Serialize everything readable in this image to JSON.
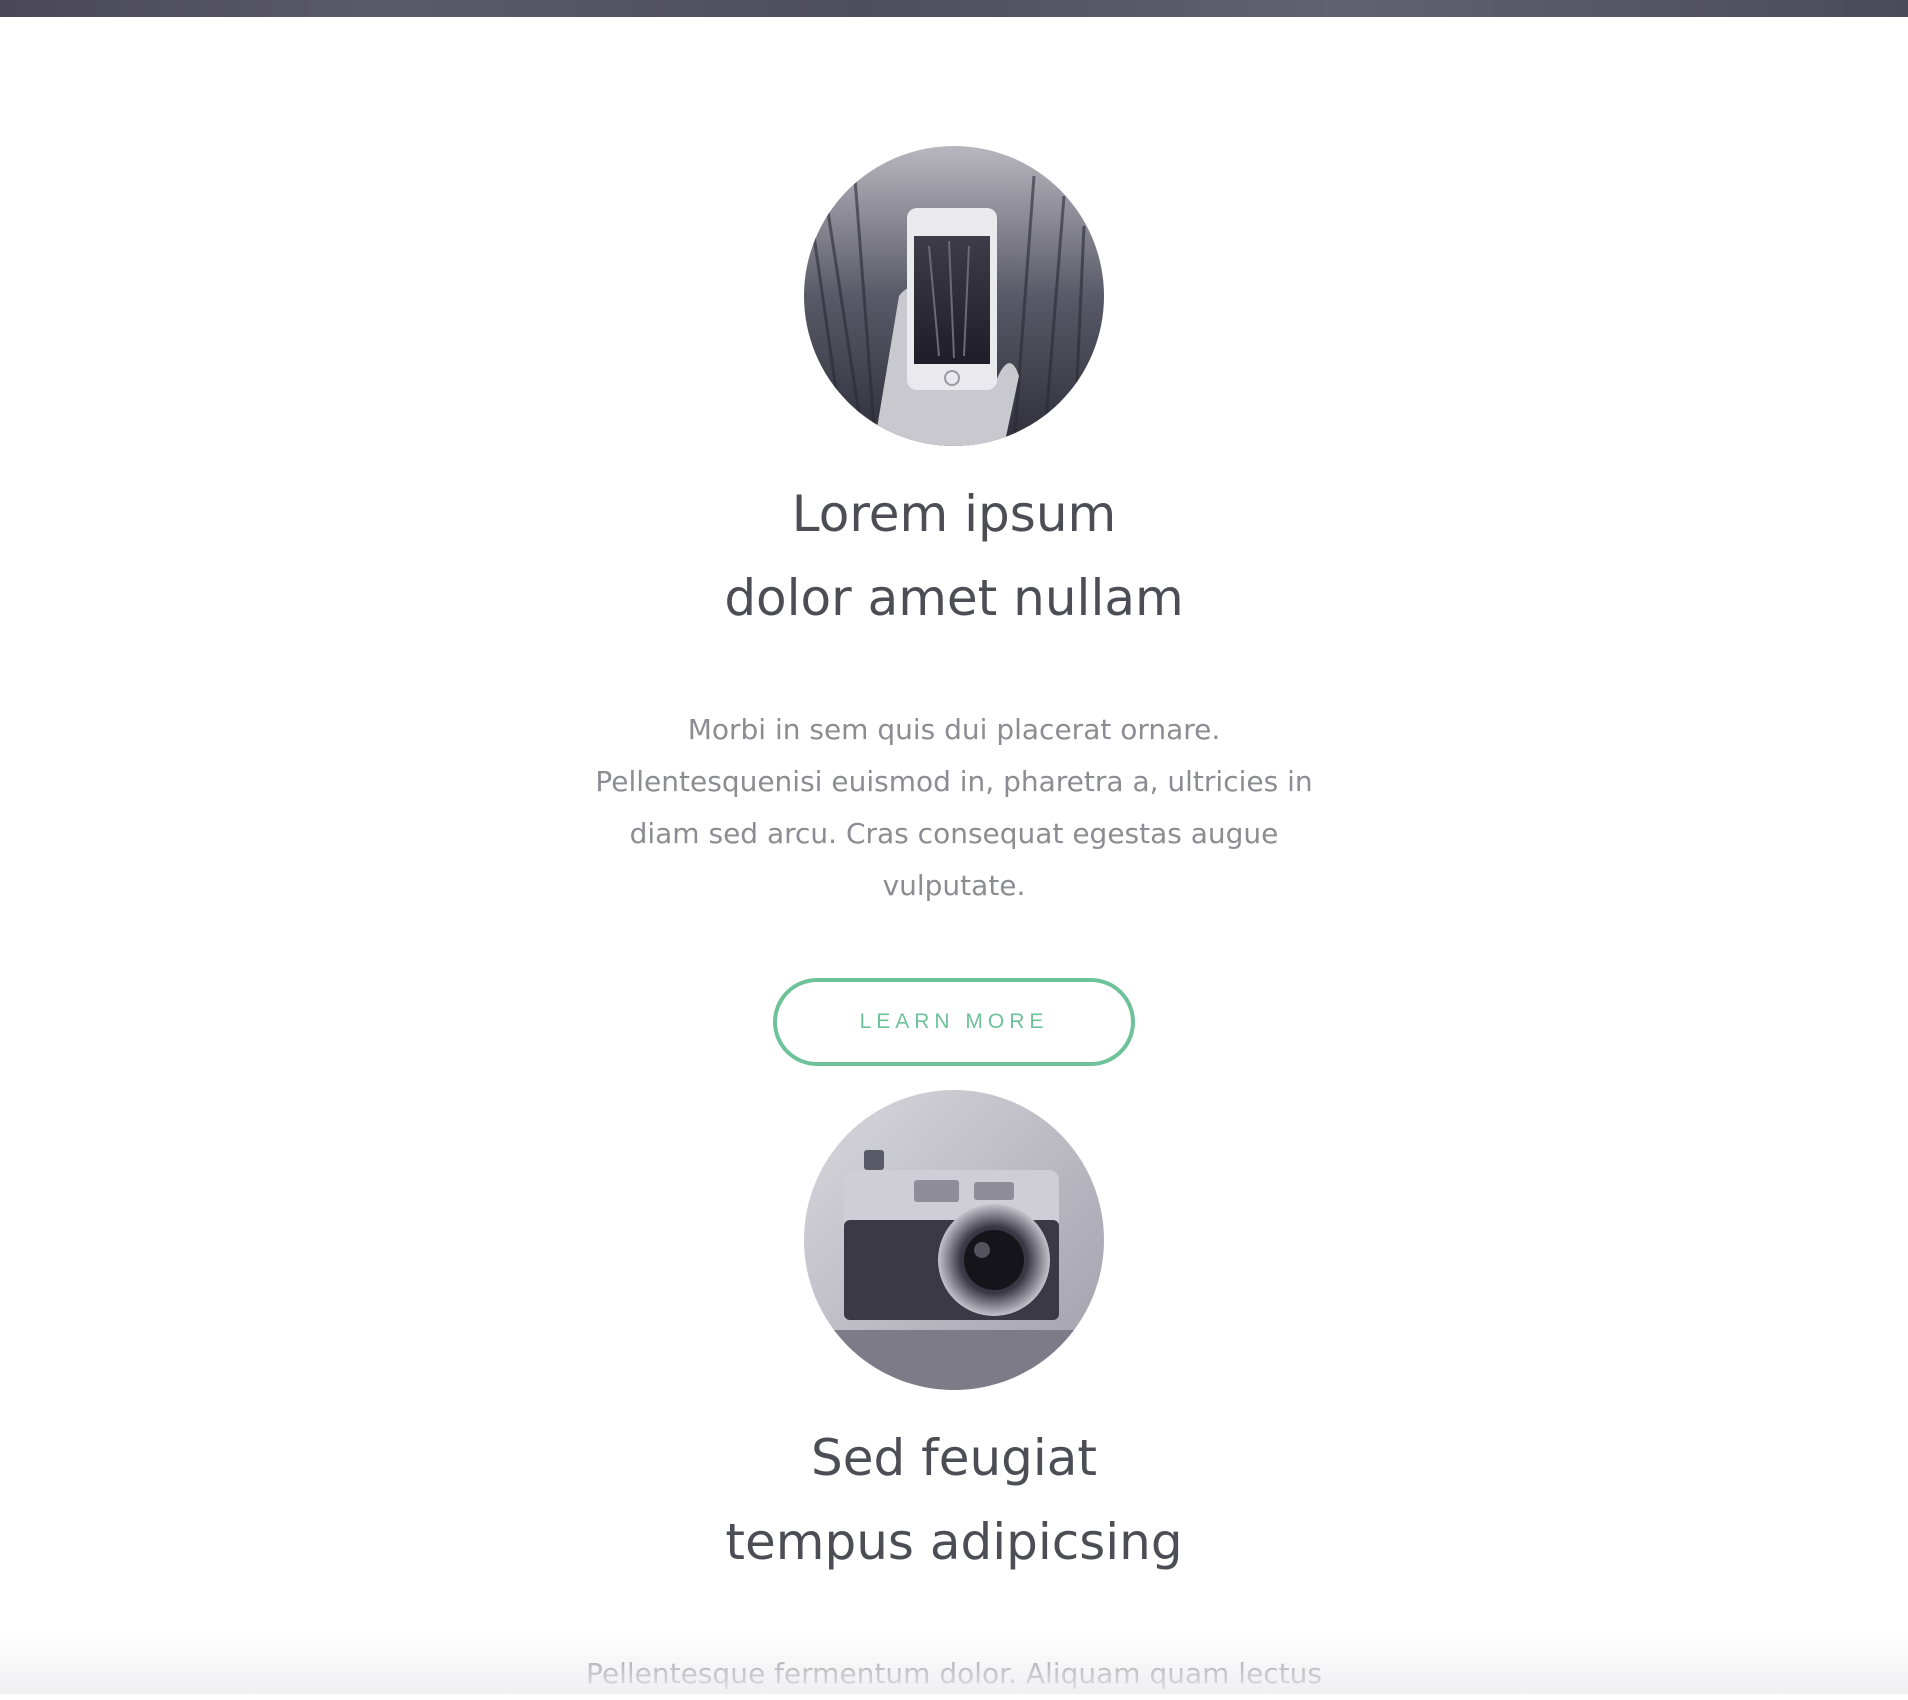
{
  "features": [
    {
      "image": "phone-photo",
      "title_line1": "Lorem ipsum",
      "title_line2": "dolor amet nullam",
      "text": "Morbi in sem quis dui placerat ornare. Pellentesquenisi euismod in, pharetra a, ultricies in diam sed arcu. Cras consequat egestas augue vulputate.",
      "button_label": "Learn More"
    },
    {
      "image": "camera-photo",
      "title_line1": "Sed feugiat",
      "title_line2": "tempus adipicsing",
      "text": "Pellentesque fermentum dolor. Aliquam quam lectus"
    }
  ],
  "colors": {
    "accent": "#6dc299",
    "heading": "#4d4d55",
    "body_text": "#8c8c93",
    "top_strip": "#4e4d5d"
  }
}
